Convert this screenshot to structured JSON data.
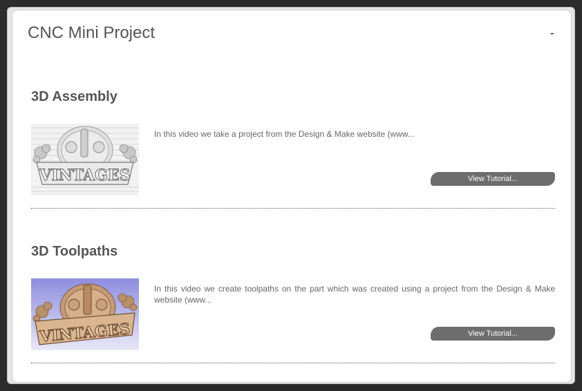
{
  "panel": {
    "title": "CNC Mini Project",
    "collapse_label": "-"
  },
  "tutorials": [
    {
      "title": "3D Assembly",
      "description": "In this video we take a project from the Design & Make website (www...",
      "button_label": "View Tutorial...",
      "thumbnail_style": "grey-wireframe"
    },
    {
      "title": "3D Toolpaths",
      "description": "In this video we create toolpaths on the part which was created using a project from the Design & Make website (www...",
      "button_label": "View Tutorial...",
      "thumbnail_style": "wood-render"
    }
  ],
  "thumbnail_sign_text": "VINTAGES",
  "colors": {
    "button_bg": "#6d6d6d",
    "wood": "#c9a27e",
    "wood_bg": "#8f8fe0"
  }
}
